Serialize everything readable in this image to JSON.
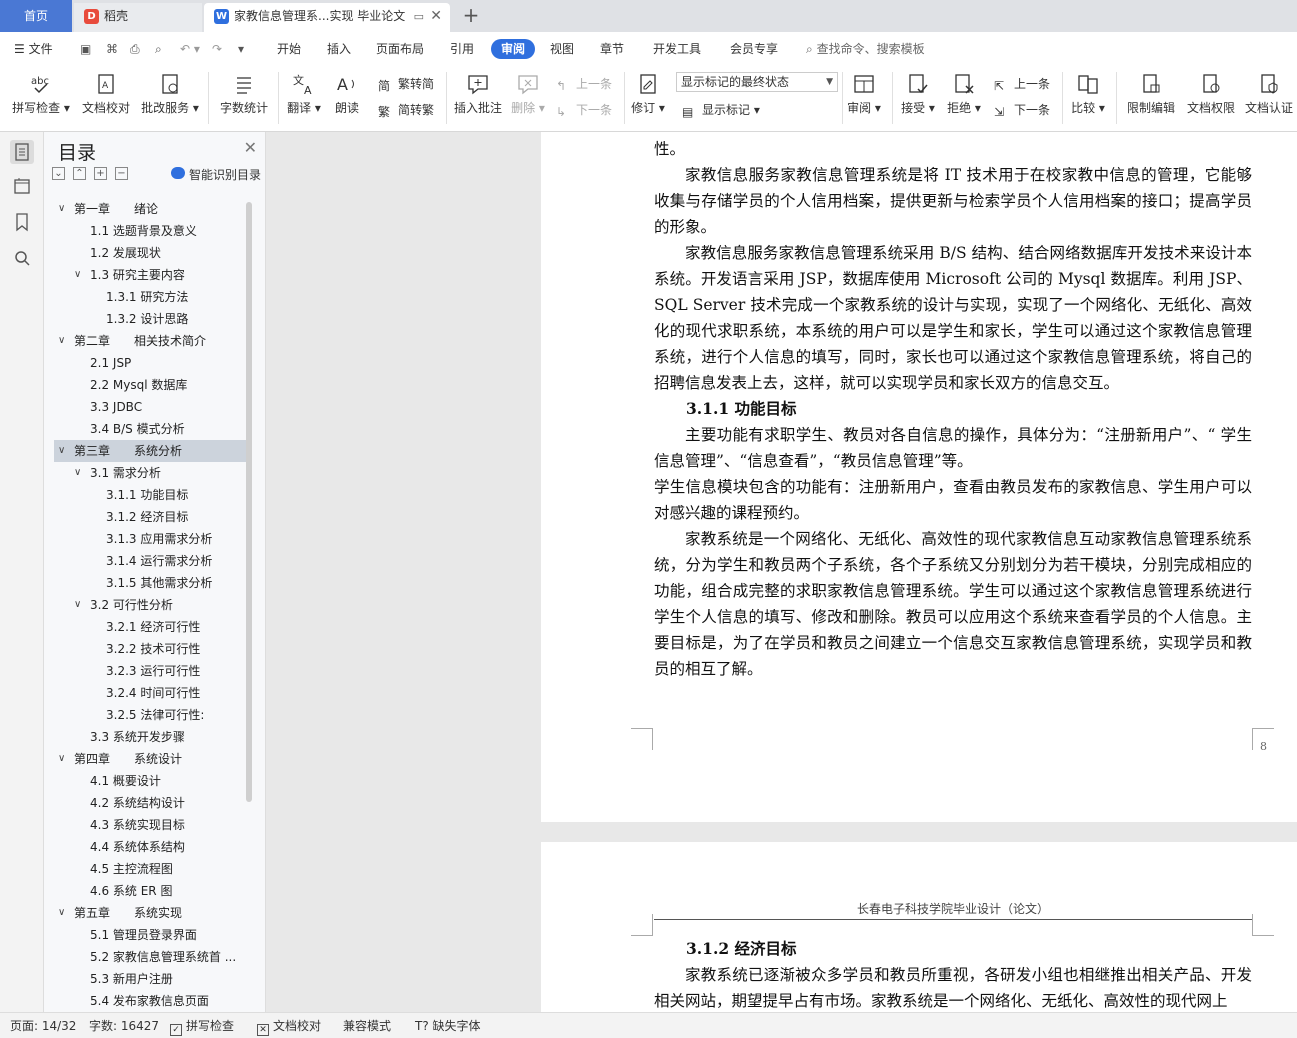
{
  "tabs": {
    "home": "首页",
    "tab1": "稻壳",
    "tab2": "家教信息管理系...实现 毕业论文"
  },
  "menu": {
    "file": "文件",
    "items": [
      "开始",
      "插入",
      "页面布局",
      "引用",
      "审阅",
      "视图",
      "章节",
      "开发工具",
      "会员专享"
    ],
    "active": "审阅",
    "search": "查找命令、搜索模板"
  },
  "ribbon": {
    "spell": "拼写检查",
    "proof": "文档校对",
    "correct": "批改服务",
    "wordcount": "字数统计",
    "translate": "翻译",
    "read": "朗读",
    "trad": "繁转简",
    "simp": "简转繁",
    "insert_comment": "插入批注",
    "delete": "删除",
    "prev": "上一条",
    "next": "下一条",
    "revise": "修订",
    "markup_state": "显示标记的最终状态",
    "show_markup": "显示标记",
    "review": "审阅",
    "accept": "接受",
    "reject": "拒绝",
    "prev2": "上一条",
    "next2": "下一条",
    "compare": "比较",
    "restrict": "限制编辑",
    "rights": "文档权限",
    "certify": "文档认证"
  },
  "toc": {
    "title": "目录",
    "ai": "智能识别目录",
    "items": [
      {
        "level": 1,
        "text": "第一章　　绪论",
        "arrow": "∨"
      },
      {
        "level": 2,
        "text": "1.1  选题背景及意义",
        "arrow": ""
      },
      {
        "level": 2,
        "text": "1.2  发展现状",
        "arrow": ""
      },
      {
        "level": 2,
        "text": "1.3  研究主要内容",
        "arrow": "∨"
      },
      {
        "level": 3,
        "text": "1.3.1  研究方法",
        "arrow": ""
      },
      {
        "level": 3,
        "text": "1.3.2  设计思路",
        "arrow": ""
      },
      {
        "level": 1,
        "text": "第二章　　相关技术简介",
        "arrow": "∨"
      },
      {
        "level": 2,
        "text": "2.1 JSP",
        "arrow": ""
      },
      {
        "level": 2,
        "text": "2.2 Mysql 数据库",
        "arrow": ""
      },
      {
        "level": 2,
        "text": "3.3 JDBC",
        "arrow": ""
      },
      {
        "level": 2,
        "text": "3.4 B/S 模式分析",
        "arrow": ""
      },
      {
        "level": 1,
        "text": "第三章　　系统分析",
        "arrow": "∨",
        "selected": true
      },
      {
        "level": 2,
        "text": "3.1 需求分析",
        "arrow": "∨"
      },
      {
        "level": 3,
        "text": "3.1.1 功能目标",
        "arrow": ""
      },
      {
        "level": 3,
        "text": "3.1.2 经济目标",
        "arrow": ""
      },
      {
        "level": 3,
        "text": "3.1.3 应用需求分析",
        "arrow": ""
      },
      {
        "level": 3,
        "text": "3.1.4 运行需求分析",
        "arrow": ""
      },
      {
        "level": 3,
        "text": "3.1.5 其他需求分析",
        "arrow": ""
      },
      {
        "level": 2,
        "text": "3.2 可行性分析",
        "arrow": "∨"
      },
      {
        "level": 3,
        "text": "3.2.1 经济可行性",
        "arrow": ""
      },
      {
        "level": 3,
        "text": "3.2.2 技术可行性",
        "arrow": ""
      },
      {
        "level": 3,
        "text": "3.2.3  运行可行性",
        "arrow": ""
      },
      {
        "level": 3,
        "text": "3.2.4  时间可行性",
        "arrow": ""
      },
      {
        "level": 3,
        "text": "3.2.5  法律可行性:",
        "arrow": ""
      },
      {
        "level": 2,
        "text": "3.3 系统开发步骤",
        "arrow": ""
      },
      {
        "level": 1,
        "text": "第四章　　系统设计",
        "arrow": "∨"
      },
      {
        "level": 2,
        "text": "4.1 概要设计",
        "arrow": ""
      },
      {
        "level": 2,
        "text": "4.2 系统结构设计",
        "arrow": ""
      },
      {
        "level": 2,
        "text": "4.3 系统实现目标",
        "arrow": ""
      },
      {
        "level": 2,
        "text": "4.4 系统体系结构",
        "arrow": ""
      },
      {
        "level": 2,
        "text": "4.5 主控流程图",
        "arrow": ""
      },
      {
        "level": 2,
        "text": "4.6 系统 ER 图",
        "arrow": ""
      },
      {
        "level": 1,
        "text": "第五章　　系统实现",
        "arrow": "∨"
      },
      {
        "level": 2,
        "text": "5.1 管理员登录界面",
        "arrow": ""
      },
      {
        "level": 2,
        "text": "5.2 家教信息管理系统首 ...",
        "arrow": ""
      },
      {
        "level": 2,
        "text": "5.3 新用户注册",
        "arrow": ""
      },
      {
        "level": 2,
        "text": "5.4 发布家教信息页面",
        "arrow": ""
      }
    ]
  },
  "doc": {
    "page1": [
      {
        "type": "p",
        "noind": true,
        "text": "性。"
      },
      {
        "type": "p",
        "text": "家教信息服务家教信息管理系统是将 IT 技术用于在校家教中信息的管理，它能够收集与存储学员的个人信用档案，提供更新与检索学员个人信用档案的接口；提高学员的形象。"
      },
      {
        "type": "p",
        "text": "家教信息服务家教信息管理系统采用 B/S 结构、结合网络数据库开发技术来设计本系统。开发语言采用 JSP，数据库使用 Microsoft 公司的 Mysql 数据库。利用 JSP、SQL Server 技术完成一个家教系统的设计与实现，实现了一个网络化、无纸化、高效化的现代求职系统，本系统的用户可以是学生和家长，学生可以通过这个家教信息管理系统，进行个人信息的填写，同时，家长也可以通过这个家教信息管理系统，将自己的招聘信息发表上去，这样，就可以实现学员和家长双方的信息交互。"
      },
      {
        "type": "h",
        "text": "3.1.1 功能目标"
      },
      {
        "type": "p",
        "text": "主要功能有求职学生、教员对各自信息的操作，具体分为：“注册新用户”、“ 学生信息管理”、“信息查看”，“教员信息管理”等。"
      },
      {
        "type": "p",
        "noind": true,
        "text": "学生信息模块包含的功能有：注册新用户，查看由教员发布的家教信息、学生用户可以对感兴趣的课程预约。"
      },
      {
        "type": "p",
        "text": "家教系统是一个网络化、无纸化、高效性的现代家教信息互动家教信息管理系统系统，分为学生和教员两个子系统，各个子系统又分别划分为若干模块，分别完成相应的功能，组合成完整的求职家教信息管理系统。学生可以通过这个家教信息管理系统进行学生个人信息的填写、修改和删除。教员可以应用这个系统来查看学员的个人信息。主要目标是，为了在学员和教员之间建立一个信息交互家教信息管理系统，实现学员和教员的相互了解。"
      }
    ],
    "page_number": "8",
    "header2": "长春电子科技学院毕业设计（论文）",
    "page2": [
      {
        "type": "h",
        "text": "3.1.2 经济目标"
      },
      {
        "type": "p",
        "text": "家教系统已逐渐被众多学员和教员所重视，各研发小组也相继推出相关产品、开发相关网站，期望提早占有市场。家教系统是一个网络化、无纸化、高效性的现代网上"
      }
    ]
  },
  "status": {
    "page": "页面: 14/32",
    "words": "字数: 16427",
    "spell": "拼写检查",
    "proof": "文档校对",
    "compat": "兼容模式",
    "font": "缺失字体"
  }
}
